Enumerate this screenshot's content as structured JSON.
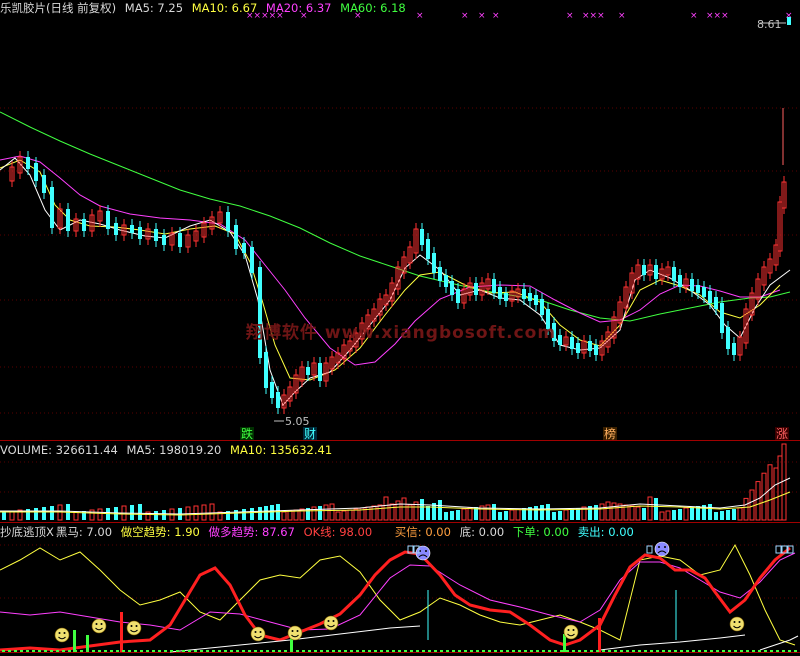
{
  "main_header": {
    "title": "乐凯胶片(日线 前复权)",
    "ma5": "MA5: 7.25",
    "ma10": "MA10: 6.67",
    "ma20": "MA20: 6.37",
    "ma60": "MA60: 6.18"
  },
  "price_labels": {
    "high": "8.61",
    "low": "5.05"
  },
  "markers": {
    "die": "跌",
    "cai": "财",
    "bang": "榜",
    "zhang": "涨"
  },
  "volume_header": {
    "volume": "VOLUME: 326611.44",
    "ma5": "MA5: 198019.20",
    "ma10": "MA10: 135632.41"
  },
  "indicator_header": {
    "name": "抄底逃顶X",
    "heima": "黑马: 7.00",
    "zuokong": "做空趋势: 1.90",
    "zuoduo": "做多趋势: 87.67",
    "okline": "OK线: 98.00",
    "maixin": "买信: 0.00",
    "di": "底: 0.00",
    "xiadan": "下单: 0.00",
    "maichu": "卖出: 0.00"
  },
  "watermark": "翔博软件  www.xiangbosoft.com",
  "colors": {
    "up": "#ff3232",
    "down": "#40ffff",
    "ma5": "#ffffff",
    "ma10": "#ffff40",
    "ma20": "#ff40ff",
    "ma60": "#40ff40",
    "divider": "#a00000"
  }
}
